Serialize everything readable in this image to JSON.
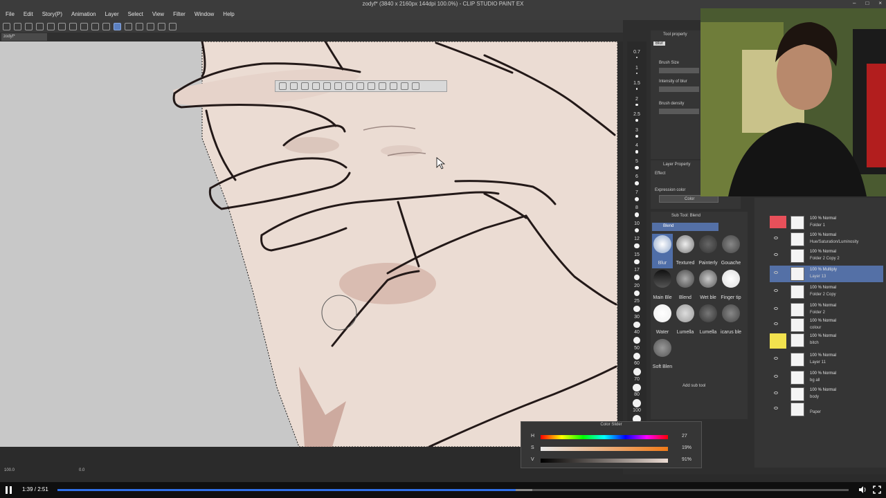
{
  "window": {
    "title": "zodyf* (3840 x 2160px 144dpi 100.0%) - CLIP STUDIO PAINT EX",
    "canvas_tab": "zodyf*"
  },
  "menu": [
    "File",
    "Edit",
    "Story(P)",
    "Animation",
    "Layer",
    "Select",
    "View",
    "Filter",
    "Window",
    "Help"
  ],
  "brush_sizes": [
    "0.7",
    "1",
    "1.5",
    "2",
    "2.5",
    "3",
    "4",
    "5",
    "6",
    "7",
    "8",
    "10",
    "12",
    "15",
    "17",
    "20",
    "25",
    "30",
    "40",
    "50",
    "60",
    "70",
    "80",
    "100"
  ],
  "tool_property": {
    "header": "Tool property",
    "tool": "Blur",
    "fields": [
      "Brush Size",
      "Intensity of blur",
      "Brush density"
    ]
  },
  "layer_property": {
    "header": "Layer Property",
    "effect": "Effect",
    "expression_color_label": "Expression color",
    "expression_color_value": "Color"
  },
  "sub_tool": {
    "header": "Sub Tool: Blend",
    "group": "Blend",
    "items": [
      "Blur",
      "Textured",
      "Painterly",
      "Gouache",
      "Main Ble",
      "Blend",
      "Wet ble",
      "Finger tip",
      "Water",
      "Lumella",
      "Lumella",
      "icarus ble",
      "Soft Blen"
    ],
    "add_label": "Add sub tool"
  },
  "layers": [
    {
      "mode": "100 % Normal",
      "name": "Folder 1"
    },
    {
      "mode": "100 % Normal",
      "name": "Hue/Saturation/Luminosity"
    },
    {
      "mode": "100 % Normal",
      "name": "Folder 2 Copy 2"
    },
    {
      "mode": "100 % Multiply",
      "name": "Layer 13"
    },
    {
      "mode": "100 % Normal",
      "name": "Folder 2 Copy"
    },
    {
      "mode": "100 % Normal",
      "name": "Folder 2"
    },
    {
      "mode": "100 % Normal",
      "name": "colour"
    },
    {
      "mode": "100 % Normal",
      "name": "bitch"
    },
    {
      "mode": "100 % Normal",
      "name": "Layer 11"
    },
    {
      "mode": "100 % Normal",
      "name": "bg all"
    },
    {
      "mode": "100 % Normal",
      "name": "body"
    },
    {
      "mode": "",
      "name": "Paper"
    }
  ],
  "color_slider": {
    "title": "Color Slider",
    "rows": [
      {
        "label": "H",
        "value": "27",
        "pos": 0.96
      },
      {
        "label": "S",
        "value": "19%",
        "pos": 0.19
      },
      {
        "label": "V",
        "value": "91%",
        "pos": 0.91
      }
    ]
  },
  "status": {
    "zoom": "100.0",
    "angle": "0.0"
  },
  "player": {
    "time": "1:39 / 2:51",
    "played": 0.579,
    "buffered": 0.6
  },
  "colors": {
    "accent": "#2f6fe8",
    "selection": "#5470a6",
    "skin": "#ecdcd3",
    "line": "#2a1f1e"
  }
}
